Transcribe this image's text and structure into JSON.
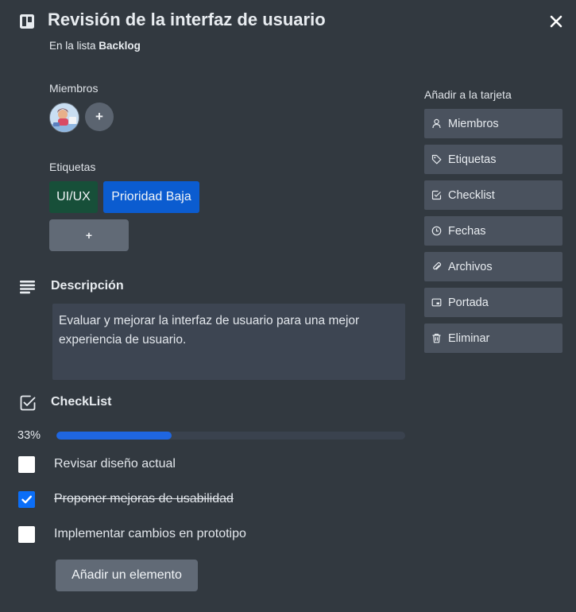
{
  "card": {
    "title": "Revisión de la interfaz de usuario",
    "list_prefix": "En la lista",
    "list_name": "Backlog",
    "close_icon": "close-icon"
  },
  "members": {
    "label": "Miembros",
    "add_label": "+"
  },
  "labels": {
    "label": "Etiquetas",
    "items": [
      {
        "text": "UI/UX",
        "color": "#174f39"
      },
      {
        "text": "Prioridad Baja",
        "color": "#0b5cd0"
      }
    ],
    "add_label": "+"
  },
  "description": {
    "title": "Descripción",
    "text": "Evaluar y mejorar la interfaz de usuario para una mejor experiencia de usuario."
  },
  "checklist": {
    "title": "CheckList",
    "percent_text": "33%",
    "progress": 0.33,
    "items": [
      {
        "text": "Revisar diseño actual",
        "checked": false
      },
      {
        "text": "Proponer mejoras de usabilidad",
        "checked": true
      },
      {
        "text": "Implementar cambios en prototipo",
        "checked": false
      }
    ],
    "add_item_label": "Añadir un elemento"
  },
  "sidebar": {
    "title": "Añadir a la tarjeta",
    "buttons": [
      {
        "label": "Miembros",
        "icon": "person-icon"
      },
      {
        "label": "Etiquetas",
        "icon": "tag-icon"
      },
      {
        "label": "Checklist",
        "icon": "checkbox-icon"
      },
      {
        "label": "Fechas",
        "icon": "clock-icon"
      },
      {
        "label": "Archivos",
        "icon": "paperclip-icon"
      },
      {
        "label": "Portada",
        "icon": "cover-icon"
      },
      {
        "label": "Eliminar",
        "icon": "trash-icon"
      }
    ]
  },
  "colors": {
    "background": "#323940",
    "accent": "#1f66e0",
    "checkbox_checked": "#0b6ef7"
  }
}
